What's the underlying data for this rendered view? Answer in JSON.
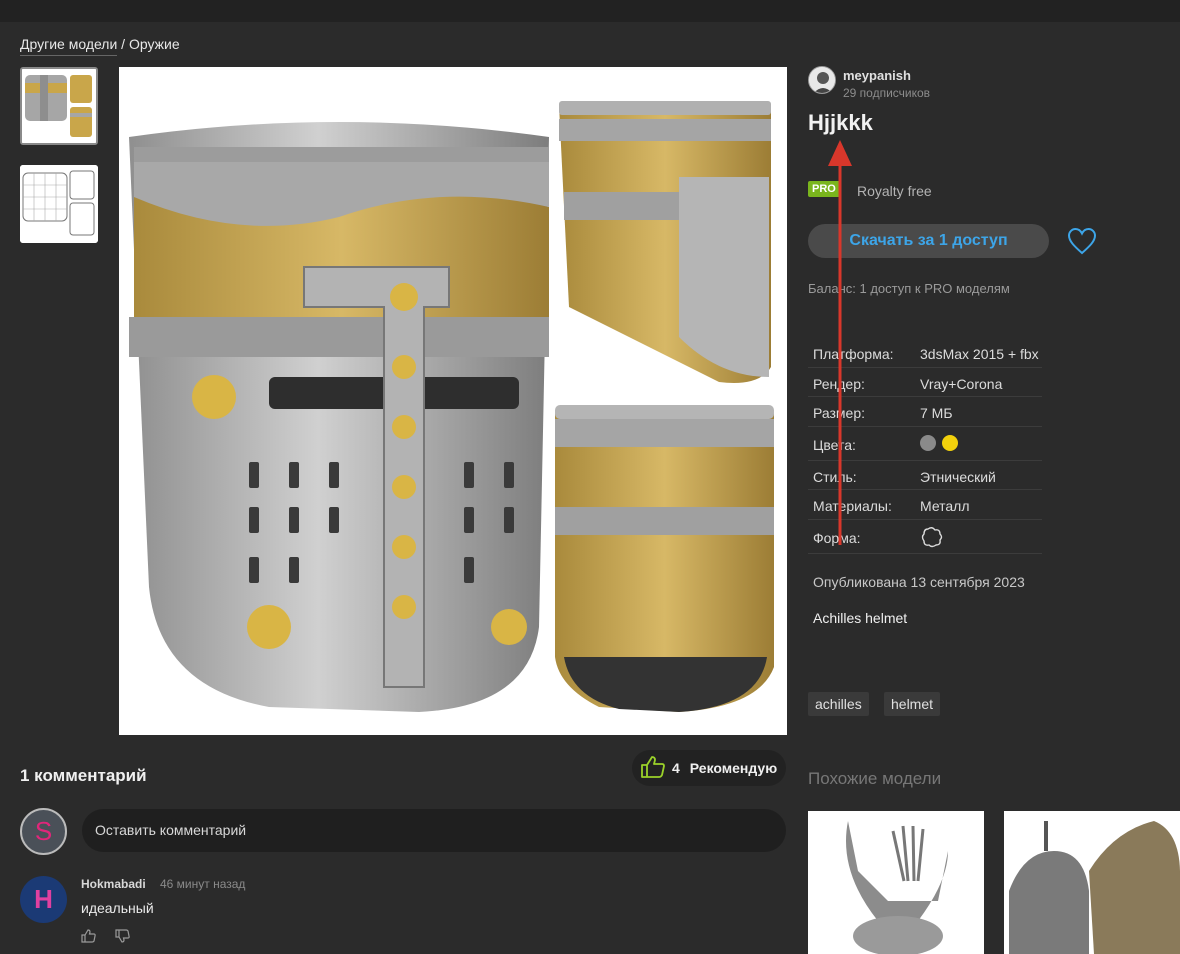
{
  "breadcrumb": {
    "section": "Другие модели",
    "separator": " / ",
    "category": "Оружие"
  },
  "author": {
    "name": "meypanish",
    "subscribers": "29 подписчиков"
  },
  "model": {
    "title": "Hjjkkk",
    "pro_badge": "PRO",
    "license": "Royalty free",
    "download_label": "Скачать за 1 доступ",
    "balance": "Баланс: 1 доступ к PRO моделям",
    "published": "Опубликована 13 сентября 2023",
    "description": "Achilles helmet"
  },
  "specs": [
    {
      "key": "Платформа:",
      "value": "3dsMax 2015 + fbx"
    },
    {
      "key": "Рендер:",
      "value": "Vray+Corona"
    },
    {
      "key": "Размер:",
      "value": "7 МБ"
    },
    {
      "key": "Цвета:",
      "colors": [
        "#8a8a8a",
        "#f2d10c"
      ]
    },
    {
      "key": "Стиль:",
      "value": "Этнический"
    },
    {
      "key": "Материалы:",
      "value": "Металл"
    },
    {
      "key": "Форма:",
      "icon": "shape-icon"
    }
  ],
  "tags": [
    "achilles",
    "helmet"
  ],
  "similar": {
    "title": "Похожие модели"
  },
  "comments": {
    "title": "1 комментарий",
    "recommend_count": "4",
    "recommend_label": "Рекомендую",
    "input_placeholder": "Оставить комментарий",
    "current_user_initial": "S",
    "items": [
      {
        "author": "Hokmabadi",
        "time": "46 минут назад",
        "text": "идеальный",
        "initial": "H"
      }
    ]
  },
  "colors": {
    "accent": "#3da5e8",
    "pro": "#7ab51d",
    "annotation_arrow": "#d9372b"
  }
}
